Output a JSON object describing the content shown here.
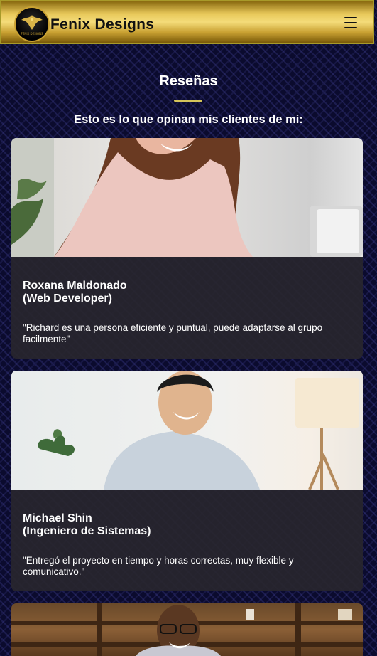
{
  "header": {
    "brand": "Fenix Designs",
    "logo_text": "FENIX DESIGNS"
  },
  "section": {
    "title": "Reseñas",
    "subtitle": "Esto es lo que opinan mis clientes de mi:"
  },
  "reviews": [
    {
      "name": "Roxana Maldonado",
      "role": "(Web Developer)",
      "quote": "\"Richard es una persona eficiente y puntual, puede adaptarse al grupo facilmente\""
    },
    {
      "name": "Michael Shin",
      "role": "(Ingeniero de Sistemas)",
      "quote": "\"Entregó el proyecto en tiempo y horas correctas, muy flexible y comunicativo.\""
    }
  ],
  "colors": {
    "accent_gold": "#d4c45a",
    "background": "#0b0b2e",
    "card": "#28262e"
  }
}
